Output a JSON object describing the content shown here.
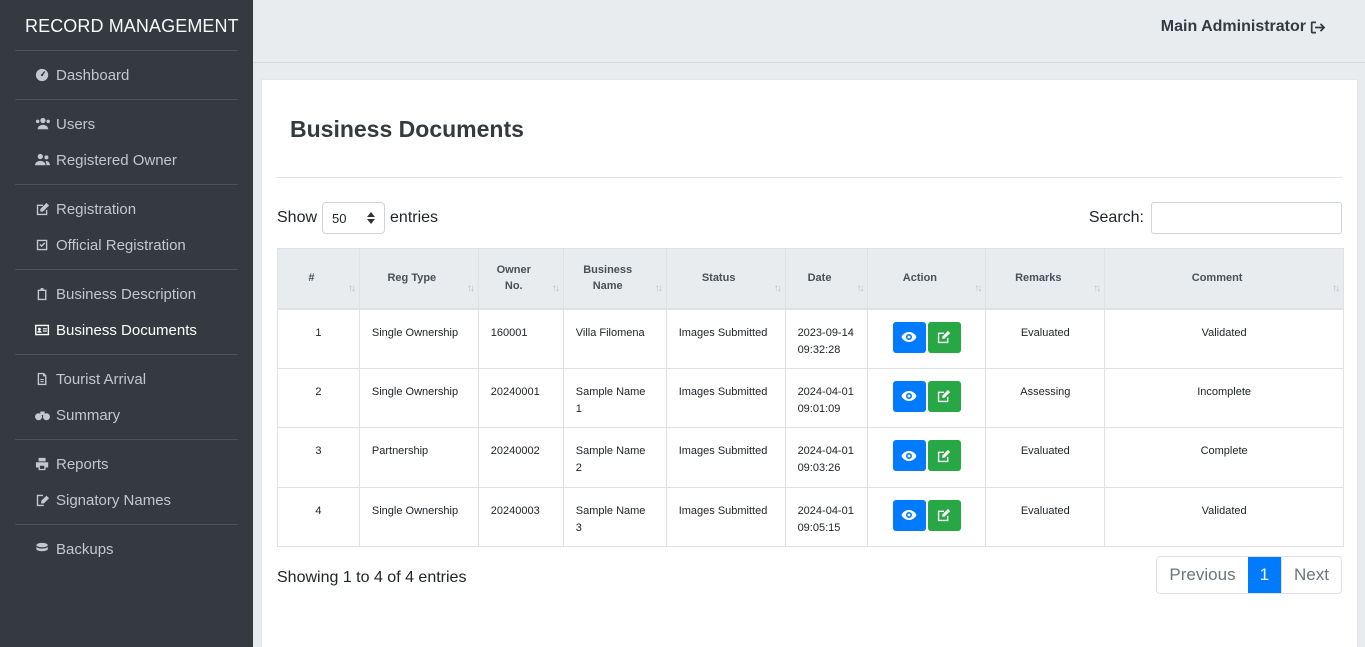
{
  "brand": "RECORD MANAGEMENT",
  "sidebar": {
    "groups": [
      [
        {
          "label": "Dashboard",
          "icon": "dashboard-icon"
        }
      ],
      [
        {
          "label": "Users",
          "icon": "users-icon"
        },
        {
          "label": "Registered Owner",
          "icon": "user-friends-icon"
        }
      ],
      [
        {
          "label": "Registration",
          "icon": "edit-icon"
        },
        {
          "label": "Official Registration",
          "icon": "check-square-icon"
        }
      ],
      [
        {
          "label": "Business Description",
          "icon": "clipboard-icon"
        },
        {
          "label": "Business Documents",
          "icon": "id-card-icon",
          "active": true
        }
      ],
      [
        {
          "label": "Tourist Arrival",
          "icon": "file-icon"
        },
        {
          "label": "Summary",
          "icon": "binoculars-icon"
        }
      ],
      [
        {
          "label": "Reports",
          "icon": "print-icon"
        },
        {
          "label": "Signatory Names",
          "icon": "signature-icon"
        }
      ],
      [
        {
          "label": "Backups",
          "icon": "database-icon"
        }
      ]
    ]
  },
  "header": {
    "user": "Main Administrator"
  },
  "page": {
    "title": "Business Documents"
  },
  "length": {
    "show": "Show",
    "value": "50",
    "entries": "entries"
  },
  "search": {
    "label": "Search:",
    "value": ""
  },
  "table": {
    "columns": [
      {
        "label": "#"
      },
      {
        "label": "Reg Type"
      },
      {
        "label": "Owner No."
      },
      {
        "label": "Business Name"
      },
      {
        "label": "Status"
      },
      {
        "label": "Date"
      },
      {
        "label": "Action"
      },
      {
        "label": "Remarks"
      },
      {
        "label": "Comment"
      }
    ],
    "rows": [
      {
        "num": "1",
        "reg_type": "Single Ownership",
        "owner_no": "160001",
        "business_name": "Villa Filomena",
        "status": "Images Submitted",
        "date": "2023-09-14 09:32:28",
        "remarks": "Evaluated",
        "comment": "Validated"
      },
      {
        "num": "2",
        "reg_type": "Single Ownership",
        "owner_no": "20240001",
        "business_name": "Sample Name 1",
        "status": "Images Submitted",
        "date": "2024-04-01 09:01:09",
        "remarks": "Assessing",
        "comment": "Incomplete"
      },
      {
        "num": "3",
        "reg_type": "Partnership",
        "owner_no": "20240002",
        "business_name": "Sample Name 2",
        "status": "Images Submitted",
        "date": "2024-04-01 09:03:26",
        "remarks": "Evaluated",
        "comment": "Complete"
      },
      {
        "num": "4",
        "reg_type": "Single Ownership",
        "owner_no": "20240003",
        "business_name": "Sample Name 3",
        "status": "Images Submitted",
        "date": "2024-04-01 09:05:15",
        "remarks": "Evaluated",
        "comment": "Validated"
      }
    ]
  },
  "footer": {
    "info": "Showing 1 to 4 of 4 entries"
  },
  "pagination": {
    "previous": "Previous",
    "current": "1",
    "next": "Next"
  },
  "colors": {
    "primary": "#007bff",
    "success": "#28a745",
    "sidebar": "#343a40"
  }
}
